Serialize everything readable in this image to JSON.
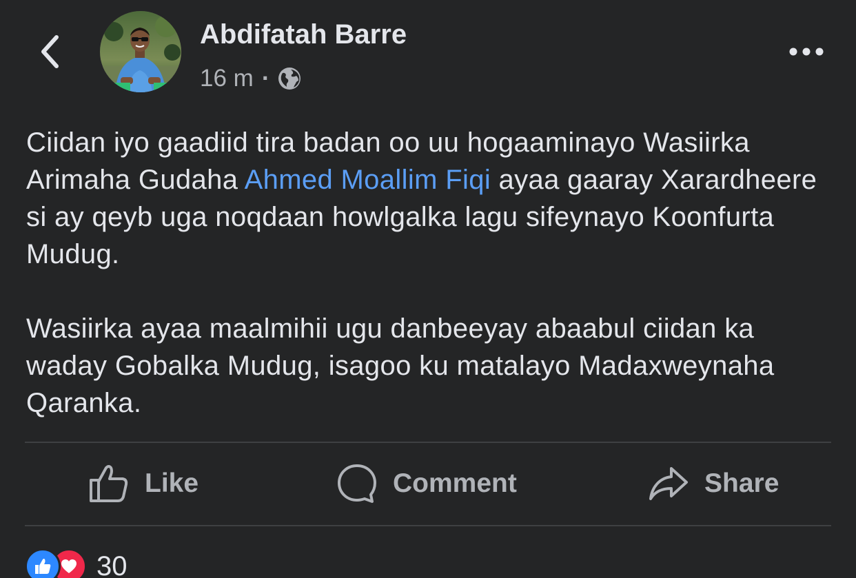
{
  "header": {
    "author_name": "Abdifatah Barre",
    "timestamp": "16 m",
    "separator": "·",
    "privacy_icon": "globe-icon",
    "back_icon": "chevron-left-icon",
    "more_icon": "more-horizontal-icon"
  },
  "post": {
    "paragraph1": {
      "before_mention": "Ciidan iyo gaadiid tira badan oo uu hogaaminayo Wasiirka Arimaha Gudaha ",
      "mention": "Ahmed Moallim Fiqi",
      "after_mention": " ayaa gaaray Xarardheere si ay qeyb uga noqdaan howlgalka lagu sifeynayo Koonfurta Mudug."
    },
    "paragraph2": "Wasiirka ayaa maalmihii ugu danbeeyay abaabul ciidan ka waday Gobalka Mudug, isagoo ku matalayo Madaxweynaha Qaranka."
  },
  "actions": {
    "like_label": "Like",
    "comment_label": "Comment",
    "share_label": "Share"
  },
  "reactions": {
    "count": "30",
    "types": [
      "like-icon",
      "love-icon"
    ]
  },
  "colors": {
    "background": "#242526",
    "text_primary": "#e4e6eb",
    "text_secondary": "#b0b3b8",
    "mention": "#5b9ef5",
    "divider": "#3e4042",
    "like_blue": "#2d88ff",
    "love_red": "#f0284a"
  }
}
